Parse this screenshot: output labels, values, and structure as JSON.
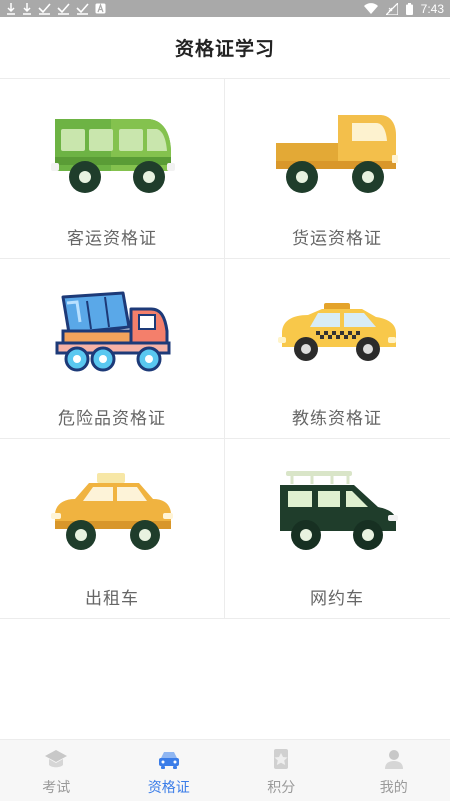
{
  "status_bar": {
    "time": "7:43",
    "left_icons": [
      "download-icon",
      "download-icon",
      "check-icon",
      "check-icon",
      "check-icon",
      "a-icon"
    ],
    "right_icons": [
      "wifi-icon",
      "signal-icon",
      "battery-icon"
    ]
  },
  "header": {
    "title": "资格证学习"
  },
  "categories": [
    {
      "label": "客运资格证",
      "icon": "bus-icon"
    },
    {
      "label": "货运资格证",
      "icon": "truck-icon"
    },
    {
      "label": "危险品资格证",
      "icon": "mixer-truck-icon"
    },
    {
      "label": "教练资格证",
      "icon": "taxi-icon"
    },
    {
      "label": "出租车",
      "icon": "cab-icon"
    },
    {
      "label": "网约车",
      "icon": "suv-icon"
    }
  ],
  "tabs": [
    {
      "label": "考试",
      "icon": "graduation-cap-icon",
      "active": false
    },
    {
      "label": "资格证",
      "icon": "car-icon",
      "active": true
    },
    {
      "label": "积分",
      "icon": "star-badge-icon",
      "active": false
    },
    {
      "label": "我的",
      "icon": "user-icon",
      "active": false
    }
  ],
  "colors": {
    "accent": "#3b7de8",
    "tab_inactive": "#9a9a9a",
    "status_bar": "#a9a9a9"
  }
}
